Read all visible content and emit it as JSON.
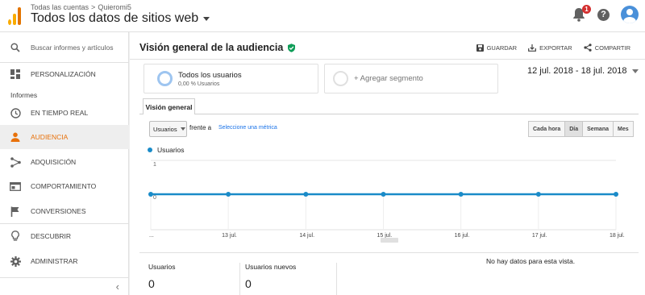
{
  "header": {
    "breadcrumb_accounts": "Todas las cuentas",
    "breadcrumb_separator": ">",
    "breadcrumb_property": "Quieromi5",
    "view_title": "Todos los datos de sitios web",
    "notification_count": "1",
    "help_symbol": "?"
  },
  "sidebar": {
    "search_placeholder": "Buscar informes y artículos",
    "customization": "PERSONALIZACIÓN",
    "reports_header": "Informes",
    "items": [
      {
        "label": "EN TIEMPO REAL",
        "icon": "clock-icon"
      },
      {
        "label": "AUDIENCIA",
        "icon": "person-icon"
      },
      {
        "label": "ADQUISICIÓN",
        "icon": "acquisition-icon"
      },
      {
        "label": "COMPORTAMIENTO",
        "icon": "behavior-icon"
      },
      {
        "label": "CONVERSIONES",
        "icon": "flag-icon"
      }
    ],
    "discover": "DESCUBRIR",
    "admin": "ADMINISTRAR",
    "collapse_symbol": "‹"
  },
  "main": {
    "title": "Visión general de la audiencia",
    "actions": {
      "save": "GUARDAR",
      "export": "EXPORTAR",
      "share": "COMPARTIR"
    },
    "segment": {
      "name": "Todos los usuarios",
      "sub": "0,00 % Usuarios",
      "add": "+ Agregar segmento"
    },
    "date_range": "12 jul. 2018 - 18 jul. 2018",
    "tab": "Visión general",
    "metric": {
      "selected": "Usuarios",
      "versus": "frente a",
      "select_link": "Seleccione una métrica"
    },
    "granularity": [
      "Cada hora",
      "Día",
      "Semana",
      "Mes"
    ],
    "granularity_selected": "Día",
    "legend_label": "Usuarios",
    "stats": [
      {
        "label": "Usuarios",
        "value": "0"
      },
      {
        "label": "Usuarios nuevos",
        "value": "0"
      }
    ],
    "no_data": "No hay datos para esta vista."
  },
  "colors": {
    "accent": "#e8710a",
    "series": "#1a8bc8",
    "link": "#1a73e8",
    "verified": "#0f9d58"
  },
  "chart_data": {
    "type": "line",
    "x": [
      "...",
      "13 jul.",
      "14 jul.",
      "15 jul.",
      "16 jul.",
      "17 jul.",
      "18 jul."
    ],
    "series": [
      {
        "name": "Usuarios",
        "values": [
          0,
          0,
          0,
          0,
          0,
          0,
          0
        ]
      }
    ],
    "ylim": [
      0,
      1
    ],
    "yticks": [
      "1",
      "0"
    ],
    "grid": true
  }
}
